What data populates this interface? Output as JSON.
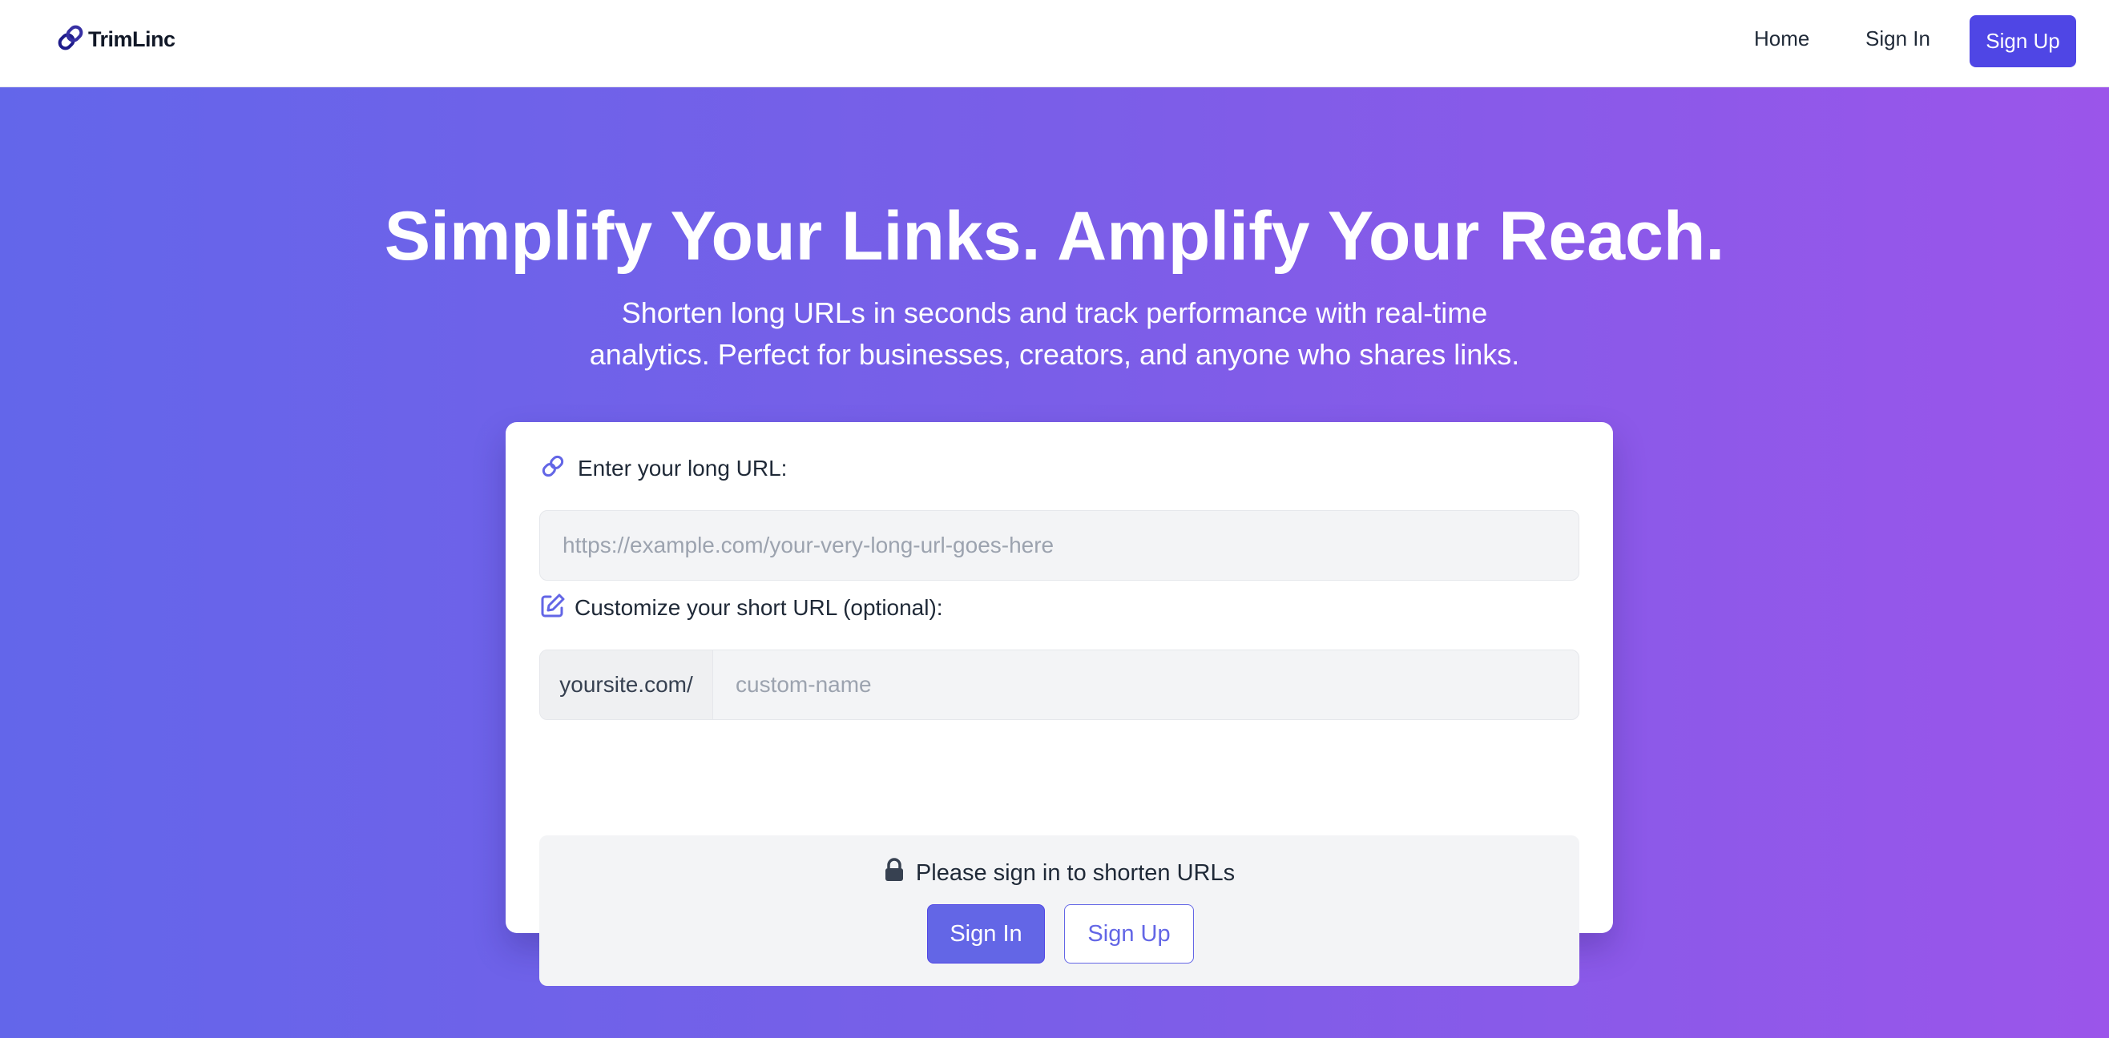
{
  "nav": {
    "brand": "TrimLinc",
    "logo_icon": "link-icon",
    "links": {
      "home": "Home",
      "sign_in": "Sign In",
      "sign_up": "Sign Up"
    }
  },
  "hero": {
    "headline": "Simplify Your Links. Amplify Your Reach.",
    "subtitle": "Shorten long URLs in seconds and track performance with real-time analytics. Perfect for businesses, creators, and anyone who shares links."
  },
  "form": {
    "url_label": "Enter your long URL:",
    "url_icon": "link-icon",
    "url_placeholder": "https://example.com/your-very-long-url-goes-here",
    "url_value": "",
    "custom_label": "Customize your short URL (optional):",
    "custom_icon": "edit-icon",
    "custom_prefix": "yoursite.com/",
    "custom_placeholder": "custom-name",
    "custom_value": ""
  },
  "auth_prompt": {
    "icon": "lock-icon",
    "message": "Please sign in to shorten URLs",
    "sign_in_label": "Sign In",
    "sign_up_label": "Sign Up"
  },
  "colors": {
    "primary": "#4f46e5",
    "accent": "#6366e6",
    "gradient_start": "#6366ea",
    "gradient_end": "#9b55ea",
    "card_bg": "#ffffff",
    "field_bg": "#f3f4f6"
  }
}
